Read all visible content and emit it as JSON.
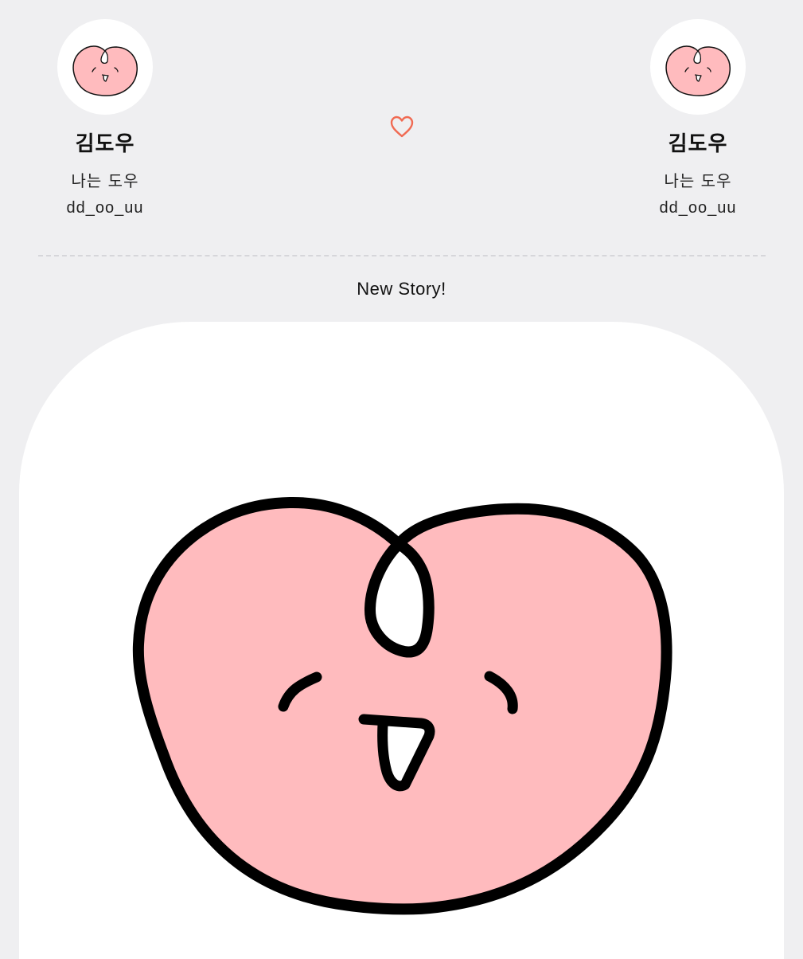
{
  "profiles": [
    {
      "name": "김도우",
      "bio": "나는 도우",
      "handle": "dd_oo_uu"
    },
    {
      "name": "김도우",
      "bio": "나는 도우",
      "handle": "dd_oo_uu"
    }
  ],
  "heart_icon": "heart-outline-icon",
  "story": {
    "label": "New Story!"
  },
  "colors": {
    "background": "#efeff1",
    "card": "#ffffff",
    "character_fill": "#ffbbbe",
    "heart_accent": "#f06a52",
    "divider": "#d6d6da"
  }
}
